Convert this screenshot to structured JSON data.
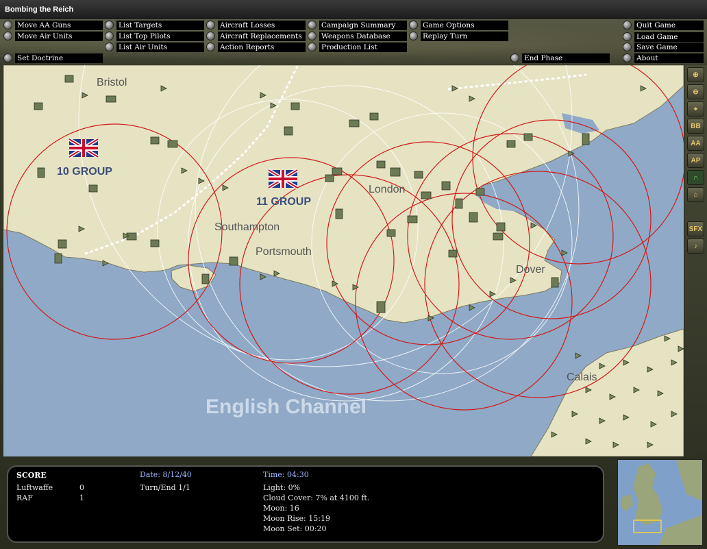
{
  "window": {
    "title": "Bombing the Reich"
  },
  "menu": {
    "move_aa_guns": "Move AA Guns",
    "move_air_units": "Move Air Units",
    "set_doctrine": "Set Doctrine",
    "list_targets": "List Targets",
    "list_top_pilots": "List Top Pilots",
    "list_air_units": "List Air Units",
    "aircraft_losses": "Aircraft Losses",
    "aircraft_replacements": "Aircraft Replacements",
    "action_reports": "Action Reports",
    "campaign_summary": "Campaign Summary",
    "weapons_database": "Weapons Database",
    "production_list": "Production List",
    "game_options": "Game Options",
    "replay_turn": "Replay Turn",
    "end_phase": "End Phase",
    "quit_game": "Quit Game",
    "load_game": "Load Game",
    "save_game": "Save Game",
    "about": "About"
  },
  "map": {
    "labels": {
      "bristol": "Bristol",
      "london": "London",
      "southampton": "Southampton",
      "portsmouth": "Portsmouth",
      "dover": "Dover",
      "calais": "Calais",
      "english_channel": "English Channel",
      "group_10": "10 GROUP",
      "group_11": "11 GROUP"
    },
    "colors": {
      "sea": "#8fa9c7",
      "land": "#e6e3c3",
      "range_ring": "#d11a1a",
      "radar_ring": "#ffffff"
    }
  },
  "toolbar": {
    "zoom_in": "zoom-in-icon",
    "zoom_out": "zoom-out-icon",
    "center": "crosshair-icon",
    "bb": "BB",
    "aa": "AA",
    "ap": "AP",
    "radar": "radar-icon",
    "factory": "factory-icon",
    "sfx": "SFX",
    "music": "music-icon"
  },
  "status": {
    "score_title": "SCORE",
    "luftwaffe_label": "Luftwaffe",
    "luftwaffe_score": "0",
    "raf_label": "RAF",
    "raf_score": "1",
    "date": "Date: 8/12/40",
    "turn": "Turn/End 1/1",
    "time": "Time: 04:30",
    "light": "Light: 0%",
    "cloud_cover": "Cloud Cover: 7% at 4100 ft.",
    "moon": "Moon: 16",
    "moon_rise": "Moon Rise: 15:19",
    "moon_set": "Moon Set: 00:20"
  }
}
